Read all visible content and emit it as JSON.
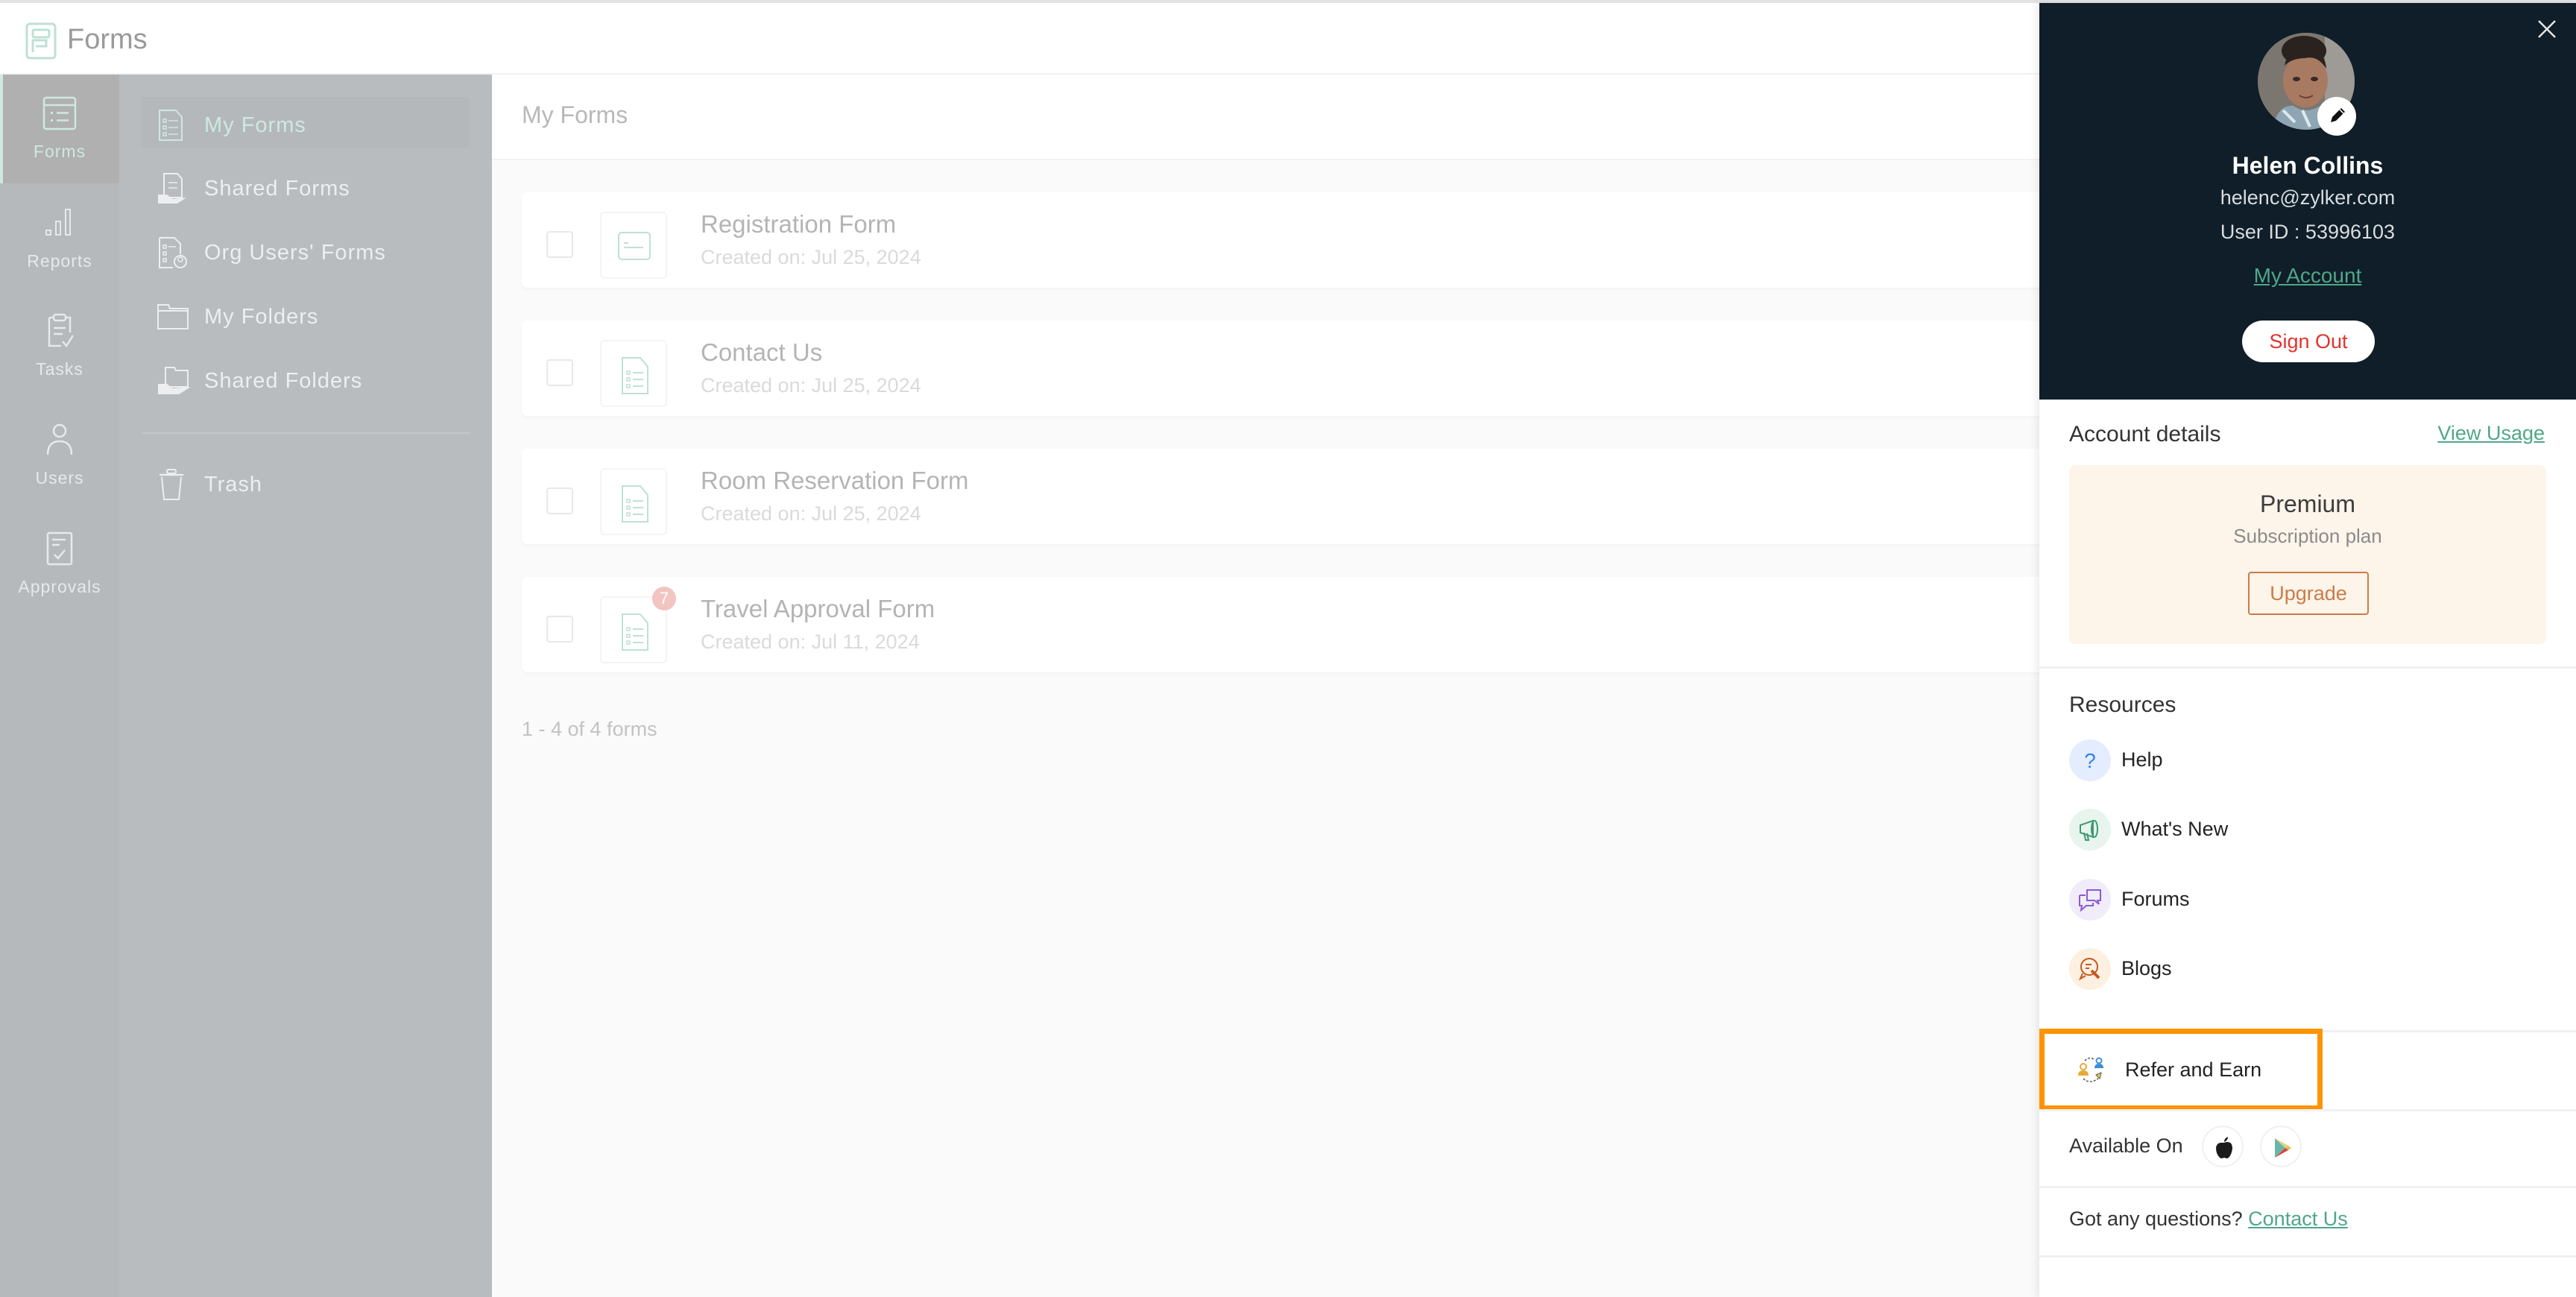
{
  "app": {
    "title": "Forms",
    "brand_color": "#4fa787"
  },
  "rail": {
    "items": [
      {
        "label": "Forms",
        "icon": "forms-icon",
        "active": true
      },
      {
        "label": "Reports",
        "icon": "reports-icon",
        "active": false
      },
      {
        "label": "Tasks",
        "icon": "tasks-icon",
        "active": false
      },
      {
        "label": "Users",
        "icon": "users-icon",
        "active": false
      },
      {
        "label": "Approvals",
        "icon": "approvals-icon",
        "active": false
      }
    ]
  },
  "subnav": {
    "items": [
      {
        "label": "My Forms",
        "icon": "my-forms-icon",
        "active": true
      },
      {
        "label": "Shared Forms",
        "icon": "shared-forms-icon",
        "active": false
      },
      {
        "label": "Org Users' Forms",
        "icon": "org-users-forms-icon",
        "active": false
      },
      {
        "label": "My Folders",
        "icon": "folder-icon",
        "active": false
      },
      {
        "label": "Shared Folders",
        "icon": "shared-folder-icon",
        "active": false
      }
    ],
    "trash": {
      "label": "Trash",
      "icon": "trash-icon"
    }
  },
  "main": {
    "title": "My Forms",
    "forms": [
      {
        "name": "Registration Form",
        "created": "Created on: Jul 25, 2024",
        "icon": "form-card-icon",
        "badge": null
      },
      {
        "name": "Contact Us",
        "created": "Created on: Jul 25, 2024",
        "icon": "form-list-icon",
        "badge": null
      },
      {
        "name": "Room Reservation Form",
        "created": "Created on: Jul 25, 2024",
        "icon": "form-list-icon",
        "badge": null
      },
      {
        "name": "Travel Approval Form",
        "created": "Created on: Jul 11, 2024",
        "icon": "form-list-icon",
        "badge": "7"
      }
    ],
    "count_text": "1 - 4 of 4 forms"
  },
  "profile": {
    "name": "Helen Collins",
    "email": "helenc@zylker.com",
    "user_id": "User ID : 53996103",
    "my_account": "My Account",
    "sign_out": "Sign Out",
    "account_details_title": "Account details",
    "view_usage": "View Usage",
    "plan": {
      "name": "Premium",
      "subtitle": "Subscription plan",
      "upgrade": "Upgrade"
    },
    "resources_title": "Resources",
    "resources": [
      {
        "label": "Help",
        "icon": "help-icon",
        "color": "#3b7ff0",
        "bg": "#e3edfd"
      },
      {
        "label": "What's New",
        "icon": "megaphone-icon",
        "color": "#3f9a72",
        "bg": "#e8f4ee"
      },
      {
        "label": "Forums",
        "icon": "forums-icon",
        "color": "#8a5ad6",
        "bg": "#f0ecfa"
      },
      {
        "label": "Blogs",
        "icon": "blogs-icon",
        "color": "#c4581e",
        "bg": "#fdf0e0"
      }
    ],
    "refer_and_earn": "Refer and Earn",
    "available_on": "Available On",
    "stores": [
      "apple-store-icon",
      "google-play-icon"
    ],
    "questions_text": "Got any questions?",
    "contact_us": "Contact Us",
    "highlight_color": "#ff9300"
  }
}
